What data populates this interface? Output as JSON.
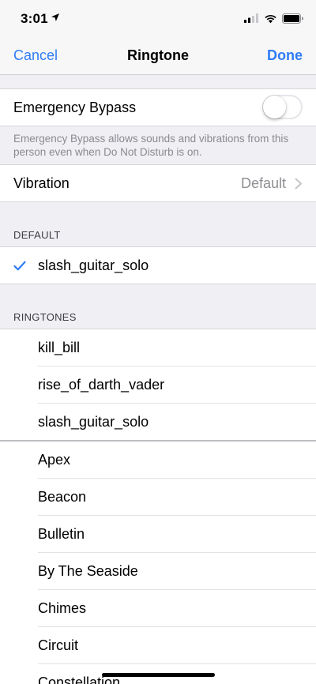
{
  "status_bar": {
    "time": "3:01",
    "icons": [
      "location-arrow-icon",
      "signal-icon",
      "wifi-icon",
      "battery-icon"
    ]
  },
  "nav": {
    "cancel_label": "Cancel",
    "title": "Ringtone",
    "done_label": "Done"
  },
  "emergency_bypass": {
    "label": "Emergency Bypass",
    "enabled": false,
    "footnote": "Emergency Bypass allows sounds and vibrations from this person even when Do Not Disturb is on."
  },
  "vibration": {
    "label": "Vibration",
    "value": "Default"
  },
  "default_section": {
    "header": "DEFAULT",
    "selected_item": "slash_guitar_solo"
  },
  "ringtones_section": {
    "header": "RINGTONES",
    "custom_items": [
      "kill_bill",
      "rise_of_darth_vader",
      "slash_guitar_solo"
    ],
    "builtin_items": [
      "Apex",
      "Beacon",
      "Bulletin",
      "By The Seaside",
      "Chimes",
      "Circuit",
      "Constellation"
    ]
  },
  "colors": {
    "accent": "#2f7cf6",
    "grouped_background": "#efeff4",
    "secondary_text": "#8e8e93"
  }
}
